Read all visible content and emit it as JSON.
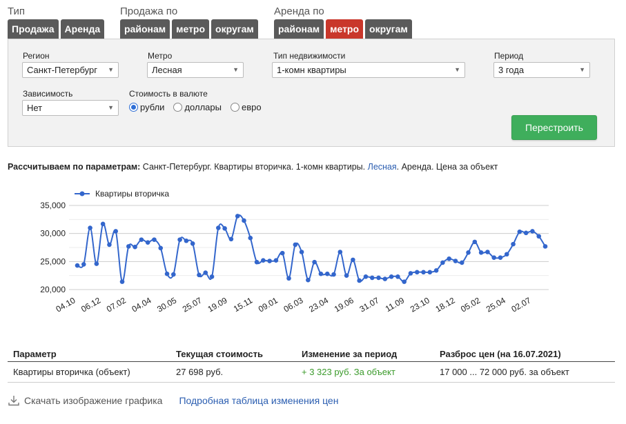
{
  "groups": {
    "type": {
      "label": "Тип",
      "tabs": [
        "Продажа",
        "Аренда"
      ]
    },
    "sale": {
      "label": "Продажа по",
      "tabs": [
        "районам",
        "метро",
        "округам"
      ]
    },
    "rent": {
      "label": "Аренда по",
      "tabs": [
        "районам",
        "метро",
        "округам"
      ],
      "active": 1
    }
  },
  "filters": {
    "region": {
      "label": "Регион",
      "value": "Санкт-Петербург"
    },
    "metro": {
      "label": "Метро",
      "value": "Лесная"
    },
    "property": {
      "label": "Тип недвижимости",
      "value": "1-комн квартиры"
    },
    "period": {
      "label": "Период",
      "value": "3 года"
    },
    "dependency": {
      "label": "Зависимость",
      "value": "Нет"
    },
    "currency": {
      "label": "Стоимость в валюте",
      "options": [
        "рубли",
        "доллары",
        "евро"
      ],
      "selected": 0
    },
    "rebuild_label": "Перестроить"
  },
  "params": {
    "prefix": "Рассчитываем по параметрам:",
    "text1": " Санкт-Петербург. Квартиры вторичка. 1-комн квартиры. ",
    "metro_link": "Лесная",
    "text2": ". Аренда. Цена за объект"
  },
  "chart_data": {
    "type": "line",
    "series": [
      {
        "name": "Квартиры вторичка",
        "color": "#3366cc",
        "values": [
          24300,
          24500,
          31000,
          24600,
          31700,
          28000,
          30400,
          21400,
          27700,
          27600,
          28900,
          28400,
          28900,
          27400,
          22800,
          22700,
          28900,
          28700,
          28200,
          22600,
          23000,
          22300,
          31000,
          30900,
          29000,
          33100,
          32300,
          29200,
          24900,
          25200,
          25100,
          25200,
          26500,
          22000,
          28000,
          26700,
          21700,
          24900,
          22800,
          22800,
          22700,
          26700,
          22500,
          25300,
          21600,
          22300,
          22100,
          22100,
          21900,
          22300,
          22300,
          21400,
          22900,
          23100,
          23100,
          23100,
          23400,
          24800,
          25500,
          25100,
          24800,
          26600,
          28500,
          26600,
          26700,
          25700,
          25700,
          26300,
          28100,
          30300,
          30100,
          30400,
          29500,
          27700
        ]
      }
    ],
    "x_ticks": [
      "04.10",
      "06.12",
      "07.02",
      "04.04",
      "30.05",
      "25.07",
      "19.09",
      "15.11",
      "09.01",
      "06.03",
      "23.04",
      "19.06",
      "31.07",
      "11.09",
      "23.10",
      "18.12",
      "05.02",
      "25.04",
      "02.07"
    ],
    "y_ticks": [
      "20,000",
      "25,000",
      "30,000",
      "35,000"
    ],
    "ylim": [
      20000,
      35000
    ],
    "grid": true,
    "legend": "top-left"
  },
  "table": {
    "headers": [
      "Параметр",
      "Текущая стоимость",
      "Изменение за период",
      "Разброс цен (на 16.07.2021)"
    ],
    "row": [
      "Квартиры вторичка (объект)",
      "27 698 руб.",
      "+ 3 323 руб. За объект",
      "17 000 ... 72 000 руб. за объект"
    ]
  },
  "footer": {
    "download": "Скачать изображение графика",
    "detail": "Подробная таблица изменения цен"
  },
  "colors": {
    "accent_tab": "#c9372b",
    "tab": "#5a5a5a",
    "button": "#3fae5c",
    "line": "#3366cc",
    "link": "#2a5db0",
    "positive": "#3a9a2a"
  }
}
